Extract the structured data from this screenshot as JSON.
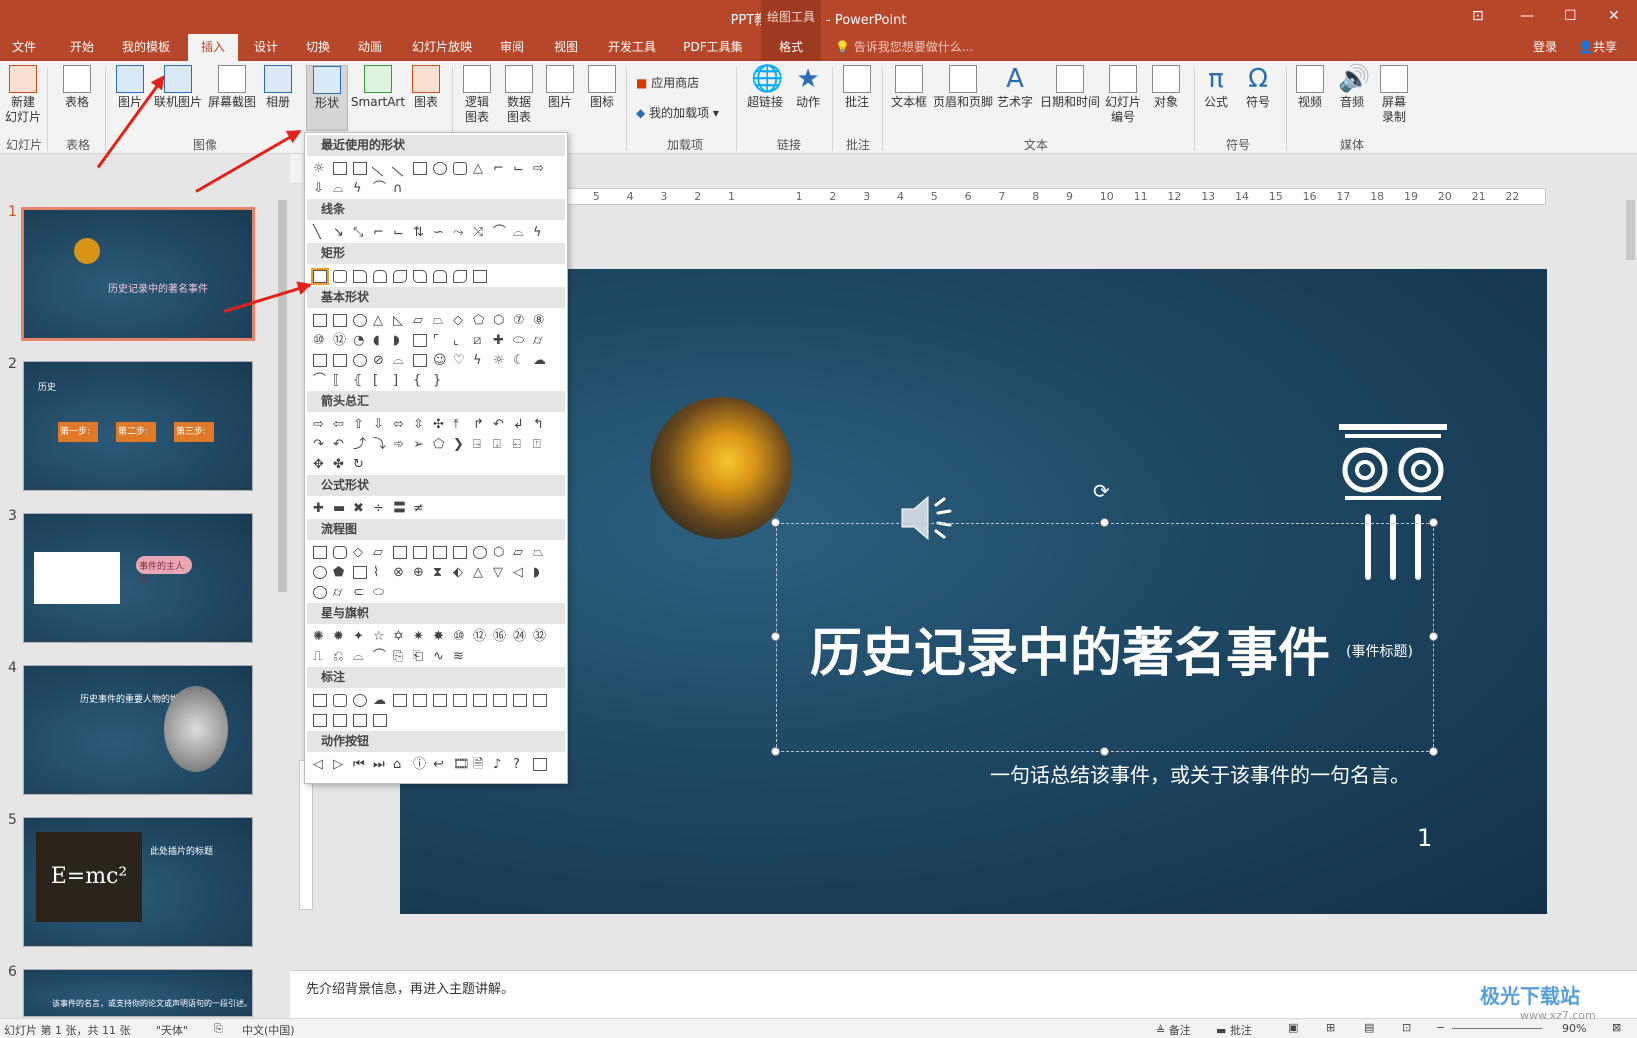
{
  "window": {
    "title": "PPT教程2.pptx - PowerPoint",
    "context_tool": "绘图工具",
    "minimize": "—",
    "restore": "☐",
    "close": "✕",
    "ribbon_opt": "⊡"
  },
  "menu": {
    "tabs": [
      "文件",
      "开始",
      "我的模板",
      "插入",
      "设计",
      "切换",
      "动画",
      "幻灯片放映",
      "审阅",
      "视图",
      "开发工具",
      "PDF工具集",
      "格式"
    ],
    "active": "插入",
    "tellme": "告诉我您想要做什么...",
    "login": "登录",
    "share": "共享"
  },
  "ribbon": {
    "buttons": [
      {
        "label": "新建\n幻灯片"
      },
      {
        "label": "表格"
      },
      {
        "label": "图片"
      },
      {
        "label": "联机图片"
      },
      {
        "label": "屏幕截图"
      },
      {
        "label": "相册"
      },
      {
        "label": "形状"
      },
      {
        "label": "SmartArt"
      },
      {
        "label": "图表"
      },
      {
        "label": "逻辑\n图表"
      },
      {
        "label": "数据\n图表"
      },
      {
        "label": "图片"
      },
      {
        "label": "图标"
      },
      {
        "label": "超链接"
      },
      {
        "label": "动作"
      },
      {
        "label": "批注"
      },
      {
        "label": "文本框"
      },
      {
        "label": "页眉和页脚"
      },
      {
        "label": "艺术字"
      },
      {
        "label": "日期和时间"
      },
      {
        "label": "幻灯片\n编号"
      },
      {
        "label": "对象"
      },
      {
        "label": "公式"
      },
      {
        "label": "符号"
      },
      {
        "label": "视频"
      },
      {
        "label": "音频"
      },
      {
        "label": "屏幕\n录制"
      }
    ],
    "small": {
      "store": "应用商店",
      "addins": "我的加载项"
    },
    "groups": [
      "幻灯片",
      "表格",
      "图像",
      "加载项",
      "链接",
      "批注",
      "文本",
      "符号",
      "媒体"
    ]
  },
  "shapes_menu": {
    "sections": [
      "最近使用的形状",
      "线条",
      "矩形",
      "基本形状",
      "箭头总汇",
      "公式形状",
      "流程图",
      "星与旗帜",
      "标注",
      "动作按钮"
    ]
  },
  "thumbnails": {
    "numbers": [
      "1",
      "2",
      "3",
      "4",
      "5",
      "6"
    ],
    "t1_title": "历史记录中的著名事件",
    "t2_label": "历史",
    "t2_steps": [
      "第一步:",
      "第二步:",
      "第三步:"
    ],
    "t3_bubble": "事件的主人公",
    "t4_title": "历史事件的重要人物的姓名",
    "t5_title": "此处插片的标题",
    "t5_formula": "E=mc²",
    "t6_quote": "该事件的名言，或支持你的论文或声明语句的一段引述。"
  },
  "slide": {
    "title": "历史记录中的著名事件",
    "subtitle": "(事件标题)",
    "tagline": "一句话总结该事件，或关于该事件的一句名言。",
    "number": "1"
  },
  "ruler": {
    "ticks": [
      "6",
      "5",
      "4",
      "3",
      "2",
      "1",
      "",
      "1",
      "2",
      "3",
      "4",
      "5",
      "6",
      "7",
      "8",
      "9",
      "10",
      "11",
      "12",
      "13",
      "14",
      "15",
      "16",
      "17",
      "18",
      "19",
      "20",
      "21",
      "22"
    ]
  },
  "notes": {
    "text": "先介绍背景信息，再进入主题讲解。"
  },
  "status": {
    "slide_info": "幻灯片 第 1 张，共 11 张",
    "theme": "\"天体\"",
    "lang": "中文(中国)",
    "notes_btn": "备注",
    "comments_btn": "批注",
    "zoom": "90%"
  },
  "watermark": {
    "text": "极光下载站",
    "sub": "www.xz7.com"
  }
}
